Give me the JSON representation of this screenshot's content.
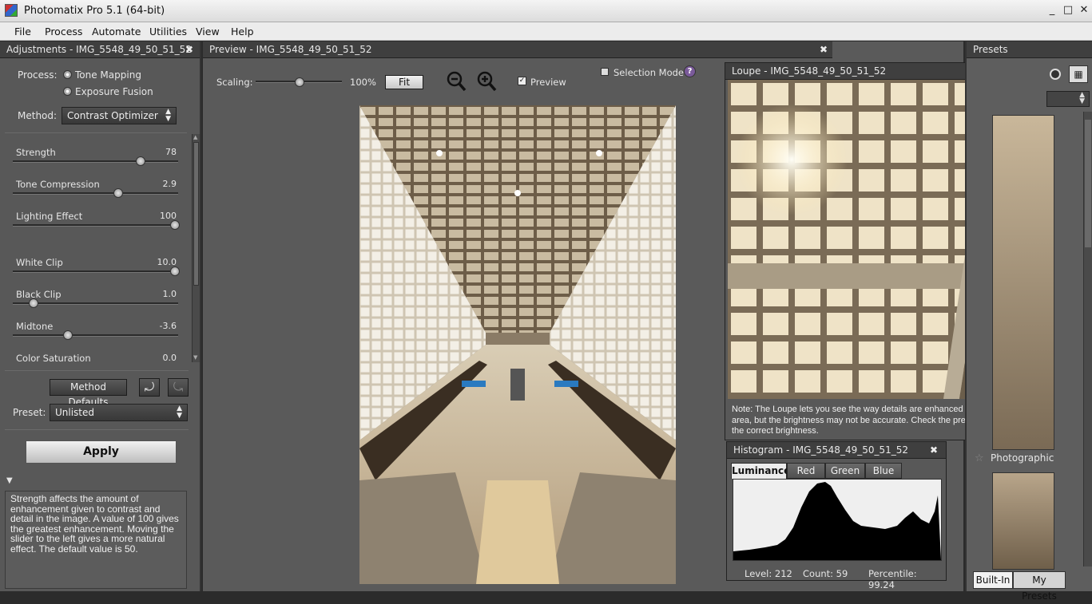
{
  "window": {
    "title": "Photomatix Pro 5.1 (64-bit)",
    "min": "_",
    "max": "□",
    "close": "✕"
  },
  "menu": [
    "File",
    "Process",
    "Automate",
    "Utilities",
    "View",
    "Help"
  ],
  "adjustments": {
    "title": "Adjustments - IMG_5548_49_50_51_52",
    "process_label": "Process:",
    "process_options": [
      "Tone Mapping",
      "Exposure Fusion"
    ],
    "method_label": "Method:",
    "method_value": "Contrast Optimizer",
    "sliders": [
      {
        "label": "Strength",
        "value": "78",
        "fraction": 0.78
      },
      {
        "label": "Tone Compression",
        "value": "2.9",
        "fraction": 0.64
      },
      {
        "label": "Lighting Effect",
        "value": "100",
        "fraction": 1.0
      },
      {
        "label": "White Clip",
        "value": "10.0",
        "fraction": 1.0
      },
      {
        "label": "Black Clip",
        "value": "1.0",
        "fraction": 0.1
      },
      {
        "label": "Midtone",
        "value": "-3.6",
        "fraction": 0.32
      },
      {
        "label": "Color Saturation",
        "value": "0.0"
      }
    ],
    "method_defaults": "Method Defaults",
    "preset_label": "Preset:",
    "preset_value": "Unlisted",
    "apply": "Apply",
    "description": "Strength affects the amount of enhancement given to contrast and detail in the image. A value of 100 gives the greatest enhancement. Moving the slider to the left gives a more natural effect. The default value is 50."
  },
  "preview": {
    "title": "Preview - IMG_5548_49_50_51_52",
    "scaling_label": "Scaling:",
    "scaling_value": "100%",
    "fit": "Fit",
    "preview_label": "Preview",
    "selection_mode": "Selection Mode",
    "help": "?"
  },
  "loupe": {
    "title": "Loupe - IMG_5548_49_50_51_52",
    "note": "Note: The Loupe lets you see the way details are enhanced inside the selected area, but the brightness may not be accurate. Check the preview window to see the correct brightness."
  },
  "histogram": {
    "title": "Histogram - IMG_5548_49_50_51_52",
    "tabs": [
      "Luminance",
      "Red",
      "Green",
      "Blue"
    ],
    "level": "Level: 212",
    "count": "Count: 59",
    "percentile": "Percentile: 99.24"
  },
  "presets": {
    "title": "Presets",
    "thumb_label": "Photographic",
    "tabs": [
      "Built-In",
      "My Presets"
    ]
  }
}
